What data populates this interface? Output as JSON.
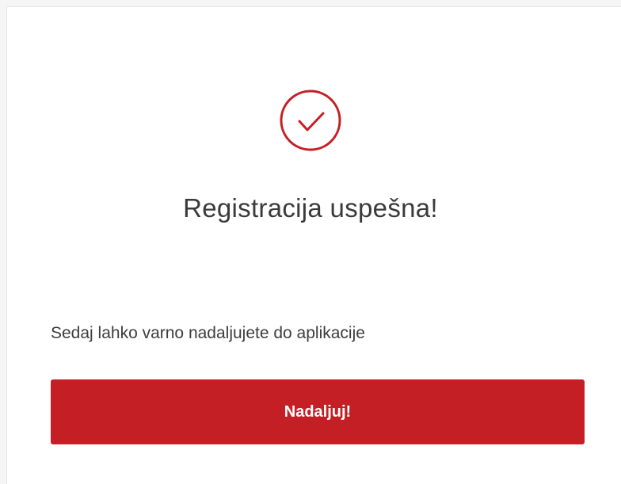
{
  "success": {
    "icon": "check-circle-icon",
    "accent_color": "#c51f26",
    "title": "Registracija uspešna!",
    "message": "Sedaj lahko varno nadaljujete do aplikacije",
    "button_label": "Nadaljuj!"
  }
}
